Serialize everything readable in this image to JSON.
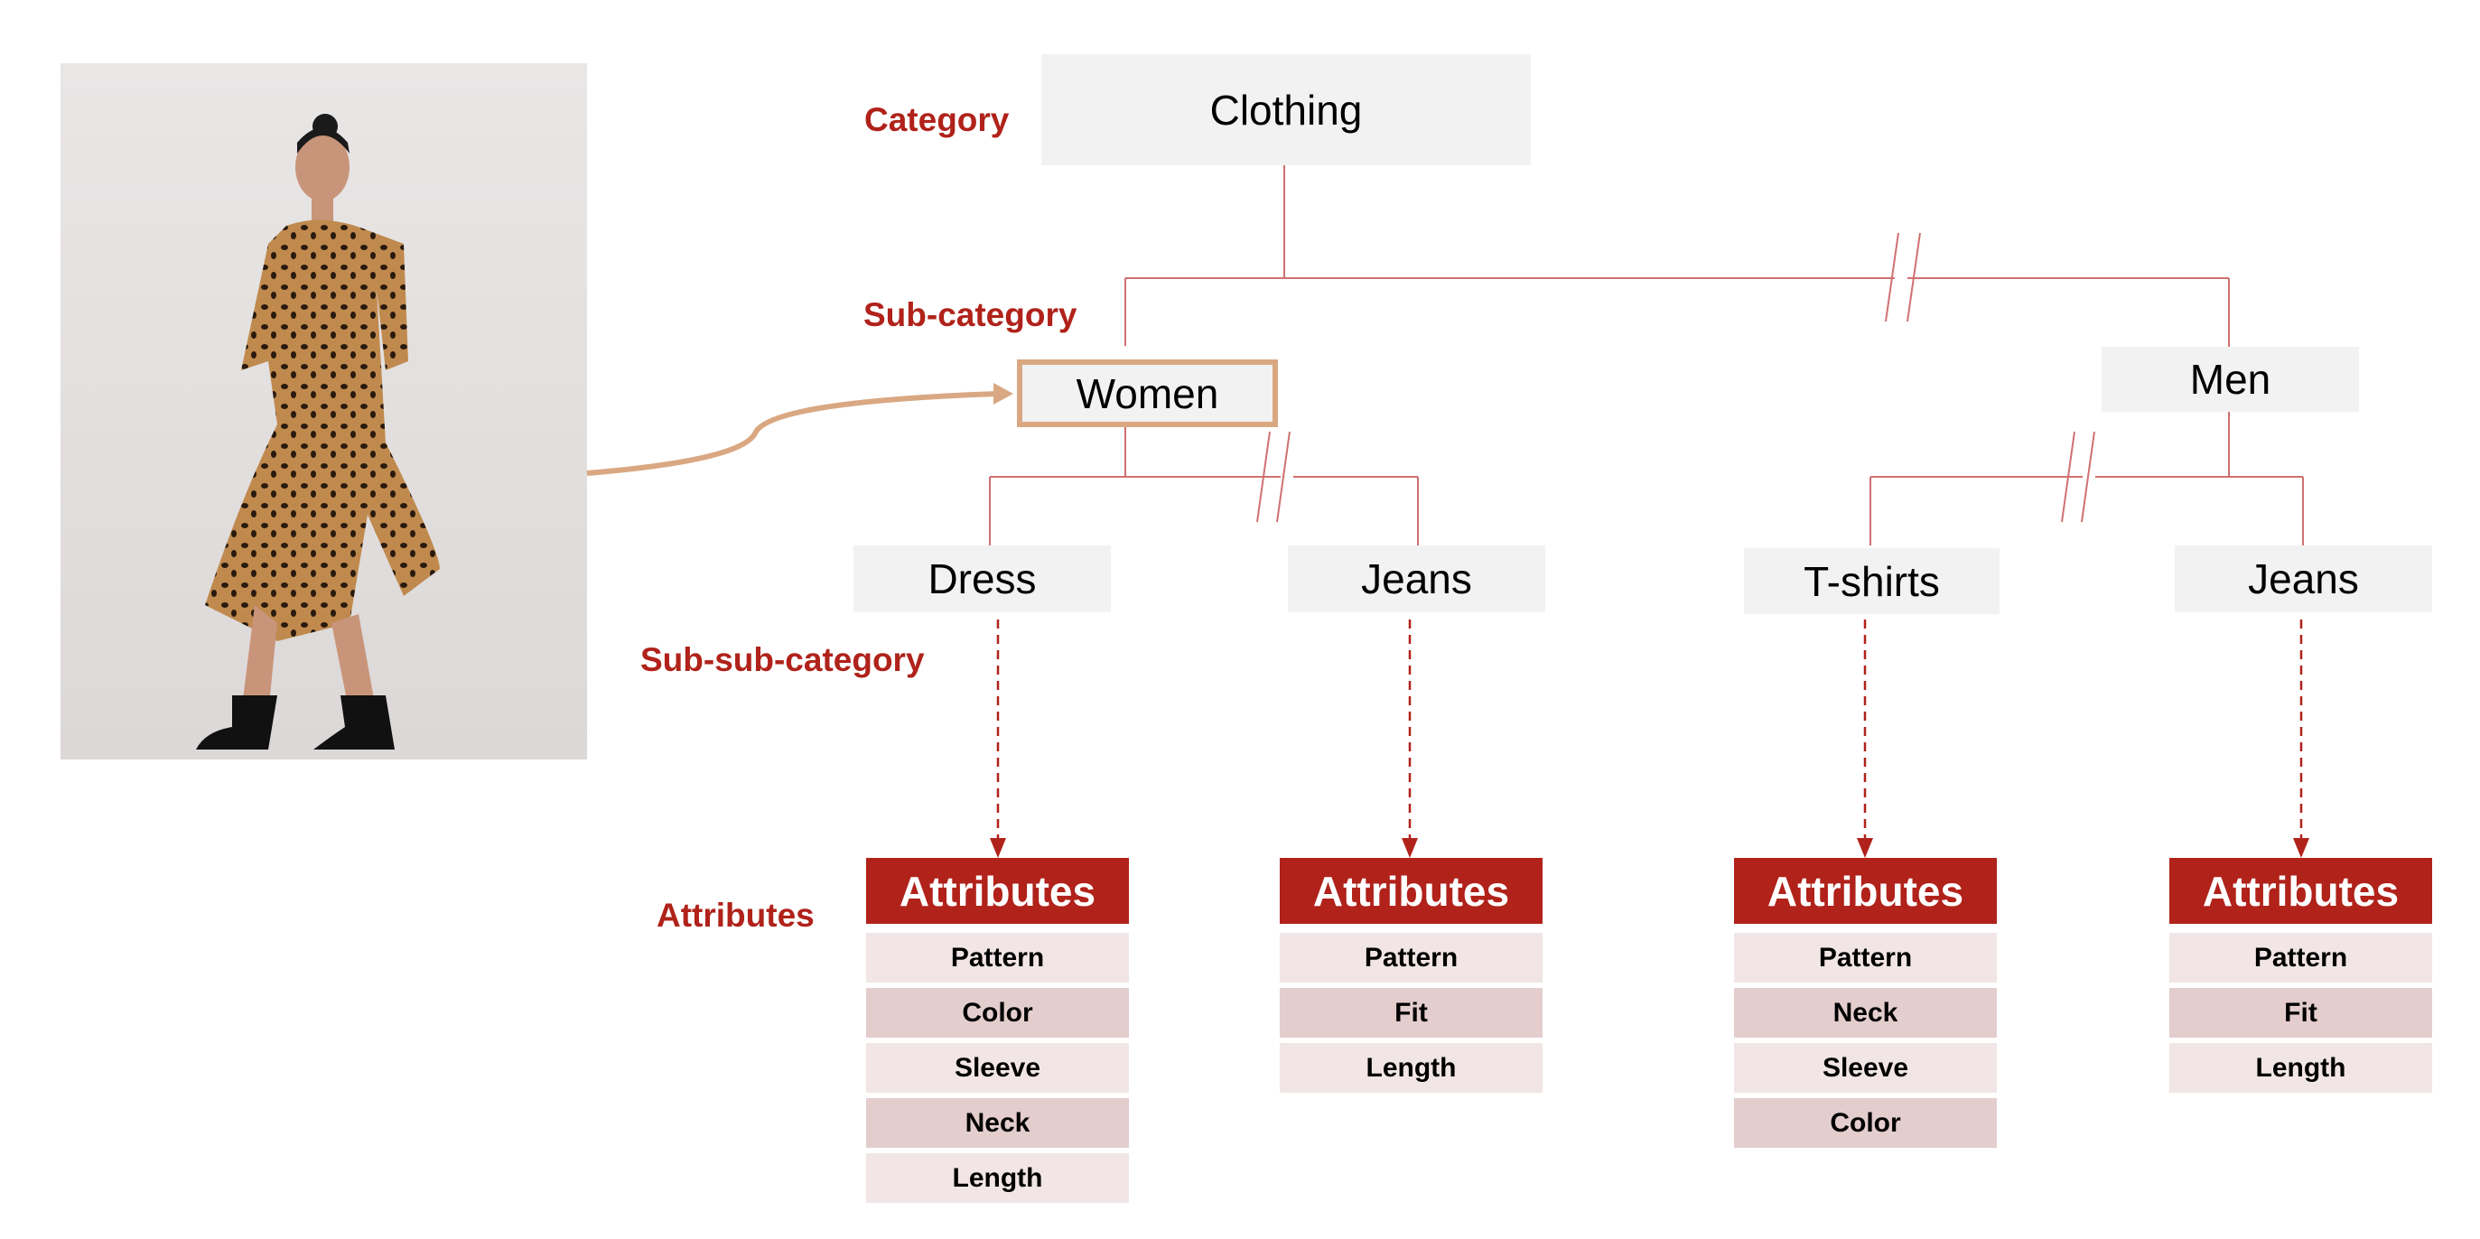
{
  "levels": {
    "category": "Category",
    "sub_category": "Sub-category",
    "sub_sub_category": "Sub-sub-category",
    "attributes": "Attributes"
  },
  "nodes": {
    "clothing": "Clothing",
    "women": "Women",
    "men": "Men",
    "dress": "Dress",
    "women_jeans": "Jeans",
    "tshirts": "T-shirts",
    "men_jeans": "Jeans"
  },
  "attribute_tables": [
    {
      "header": "Attributes",
      "items": [
        "Pattern",
        "Color",
        "Sleeve",
        "Neck",
        "Length"
      ]
    },
    {
      "header": "Attributes",
      "items": [
        "Pattern",
        "Fit",
        "Length"
      ]
    },
    {
      "header": "Attributes",
      "items": [
        "Pattern",
        "Neck",
        "Sleeve",
        "Color"
      ]
    },
    {
      "header": "Attributes",
      "items": [
        "Pattern",
        "Fit",
        "Length"
      ]
    }
  ],
  "colors": {
    "accent_red": "#b0221a",
    "highlight_border": "#d9a882",
    "connector": "#d07070",
    "node_bg": "#f2f2f2"
  },
  "photo": {
    "subject": "woman in leopard print dress"
  }
}
